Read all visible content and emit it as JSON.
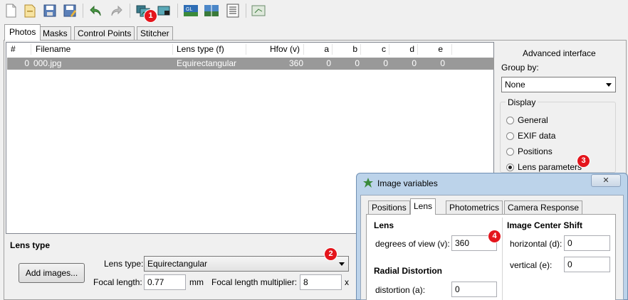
{
  "toolbar": {
    "buttons": [
      "new-file-icon",
      "open-file-icon",
      "save-icon",
      "save-as-icon",
      "undo-icon",
      "redo-icon",
      "add-images-icon",
      "remove-images-icon",
      "gl-preview-icon",
      "fast-preview-icon",
      "list-view-icon",
      "crop-icon"
    ],
    "badge1": "1"
  },
  "tabs": [
    "Photos",
    "Masks",
    "Control Points",
    "Stitcher"
  ],
  "table": {
    "columns": [
      "#",
      "Filename",
      "Lens type (f)",
      "Hfov (v)",
      "a",
      "b",
      "c",
      "d",
      "e"
    ],
    "rows": [
      {
        "num": "0",
        "filename": "000.jpg",
        "lens": "Equirectangular",
        "hfov": "360",
        "a": "0",
        "b": "0",
        "c": "0",
        "d": "0",
        "e": "0"
      }
    ]
  },
  "right": {
    "advanced": "Advanced interface",
    "group_by_label": "Group by:",
    "group_by_value": "None",
    "display_label": "Display",
    "options": [
      "General",
      "EXIF data",
      "Positions",
      "Lens parameters"
    ],
    "selected": "Lens parameters",
    "badge3": "3"
  },
  "lens": {
    "section": "Lens type",
    "add_images": "Add images...",
    "lens_type_label": "Lens type:",
    "lens_type_value": "Equirectangular",
    "focal_label": "Focal length:",
    "focal_value": "0.77",
    "focal_unit": "mm",
    "multiplier_label": "Focal length multiplier:",
    "multiplier_value": "8",
    "multiplier_unit": "x",
    "badge2": "2"
  },
  "dialog": {
    "title": "Image variables",
    "close": "✕",
    "tabs": [
      "Positions",
      "Lens",
      "Photometrics",
      "Camera Response"
    ],
    "lens_section": "Lens",
    "dov_label": "degrees of view (v):",
    "dov_value": "360",
    "radial_section": "Radial Distortion",
    "dist_label": "distortion (a):",
    "dist_value": "0",
    "shift_section": "Image Center Shift",
    "horiz_label": "horizontal (d):",
    "horiz_value": "0",
    "vert_label": "vertical (e):",
    "vert_value": "0",
    "badge4": "4"
  },
  "colors": {
    "selection": "#999999",
    "badge": "#e4151c",
    "dialog_frame": "#bcd3ea"
  }
}
